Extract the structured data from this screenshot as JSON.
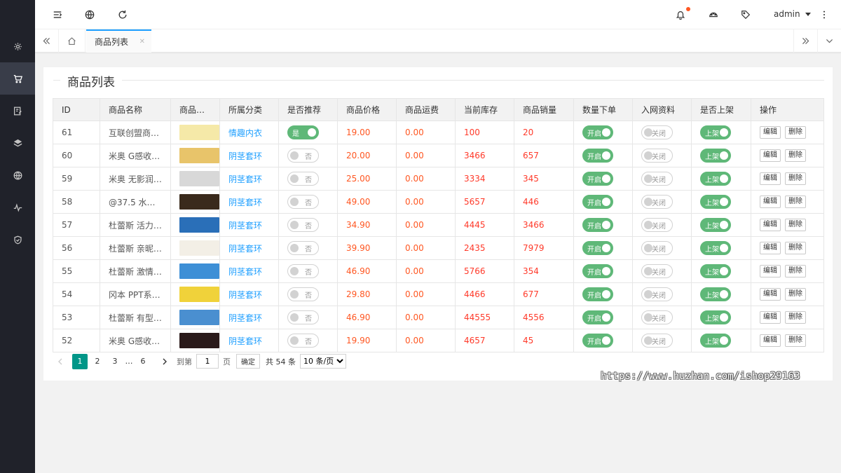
{
  "header": {
    "user": "admin"
  },
  "tabs": {
    "active_label": "商品列表"
  },
  "card": {
    "title": "商品列表"
  },
  "table": {
    "columns": [
      "ID",
      "商品名称",
      "商品…",
      "所属分类",
      "是否推荐",
      "商品价格",
      "商品运费",
      "当前库存",
      "商品销量",
      "数量下单",
      "入网资料",
      "是否上架",
      "操作"
    ],
    "labels": {
      "recommend_on": "是",
      "recommend_off": "否",
      "order_on": "开启",
      "net_off": "关闭",
      "listed_on": "上架",
      "edit": "编辑",
      "delete": "删除"
    },
    "rows": [
      {
        "id": "61",
        "name": "互联创盟商…",
        "thumb_color": "#f5e9a8",
        "category": "情趣内衣",
        "recommend": true,
        "price": "19.00",
        "freight": "0.00",
        "stock": "100",
        "sales": "20"
      },
      {
        "id": "60",
        "name": "米奥 G感收…",
        "thumb_color": "#e8c46a",
        "category": "阴茎套环",
        "recommend": false,
        "price": "20.00",
        "freight": "0.00",
        "stock": "3466",
        "sales": "657"
      },
      {
        "id": "59",
        "name": "米奥 无影润…",
        "thumb_color": "#d8d8d8",
        "category": "阴茎套环",
        "recommend": false,
        "price": "25.00",
        "freight": "0.00",
        "stock": "3334",
        "sales": "345"
      },
      {
        "id": "58",
        "name": "@37.5 水溶…",
        "thumb_color": "#3a2a1c",
        "category": "阴茎套环",
        "recommend": false,
        "price": "49.00",
        "freight": "0.00",
        "stock": "5657",
        "sales": "446"
      },
      {
        "id": "57",
        "name": "杜蕾斯 活力…",
        "thumb_color": "#2a6fb8",
        "category": "阴茎套环",
        "recommend": false,
        "price": "34.90",
        "freight": "0.00",
        "stock": "4445",
        "sales": "3466"
      },
      {
        "id": "56",
        "name": "杜蕾斯 亲昵…",
        "thumb_color": "#f3efe6",
        "category": "阴茎套环",
        "recommend": false,
        "price": "39.90",
        "freight": "0.00",
        "stock": "2435",
        "sales": "7979"
      },
      {
        "id": "55",
        "name": "杜蕾斯 激情…",
        "thumb_color": "#3d8fd6",
        "category": "阴茎套环",
        "recommend": false,
        "price": "46.90",
        "freight": "0.00",
        "stock": "5766",
        "sales": "354"
      },
      {
        "id": "54",
        "name": "冈本 PPT系…",
        "thumb_color": "#f0d23a",
        "category": "阴茎套环",
        "recommend": false,
        "price": "29.80",
        "freight": "0.00",
        "stock": "4466",
        "sales": "677"
      },
      {
        "id": "53",
        "name": "杜蕾斯 有型…",
        "thumb_color": "#4a8fd0",
        "category": "阴茎套环",
        "recommend": false,
        "price": "46.90",
        "freight": "0.00",
        "stock": "44555",
        "sales": "4556"
      },
      {
        "id": "52",
        "name": "米奥 G感收…",
        "thumb_color": "#2a1a1a",
        "category": "阴茎套环",
        "recommend": false,
        "price": "19.90",
        "freight": "0.00",
        "stock": "4657",
        "sales": "45"
      }
    ]
  },
  "pagination": {
    "pages": [
      "1",
      "2",
      "3",
      "…",
      "6"
    ],
    "current": "1",
    "goto_label": "到第",
    "goto_value": "1",
    "page_unit": "页",
    "confirm": "确定",
    "total": "共 54 条",
    "per_page": "10 条/页"
  },
  "watermark": "https://www.huzhan.com/ishop29163"
}
